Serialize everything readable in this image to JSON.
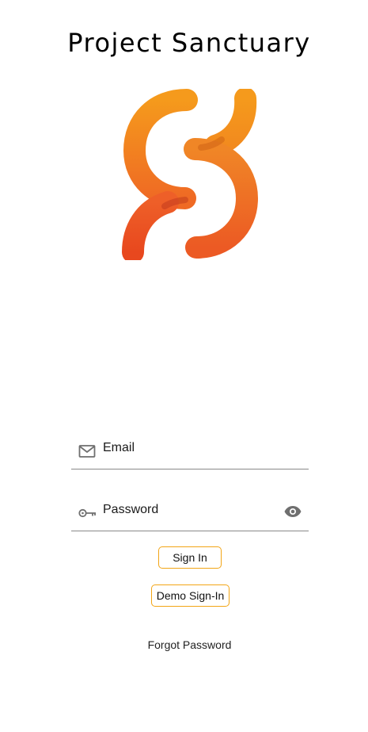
{
  "app": {
    "title": "Project Sanctuary"
  },
  "brand": {
    "colors": {
      "orange_light": "#F59A1C",
      "orange_dark": "#E84E1E",
      "accent_border": "#F2A516"
    }
  },
  "login": {
    "email": {
      "placeholder": "Email",
      "value": "",
      "icon": "mail-icon"
    },
    "password": {
      "placeholder": "Password",
      "value": "",
      "icon": "key-icon",
      "toggle_icon": "eye-icon"
    },
    "signin_label": "Sign In",
    "demo_label": "Demo Sign-In",
    "forgot_label": "Forgot Password"
  }
}
